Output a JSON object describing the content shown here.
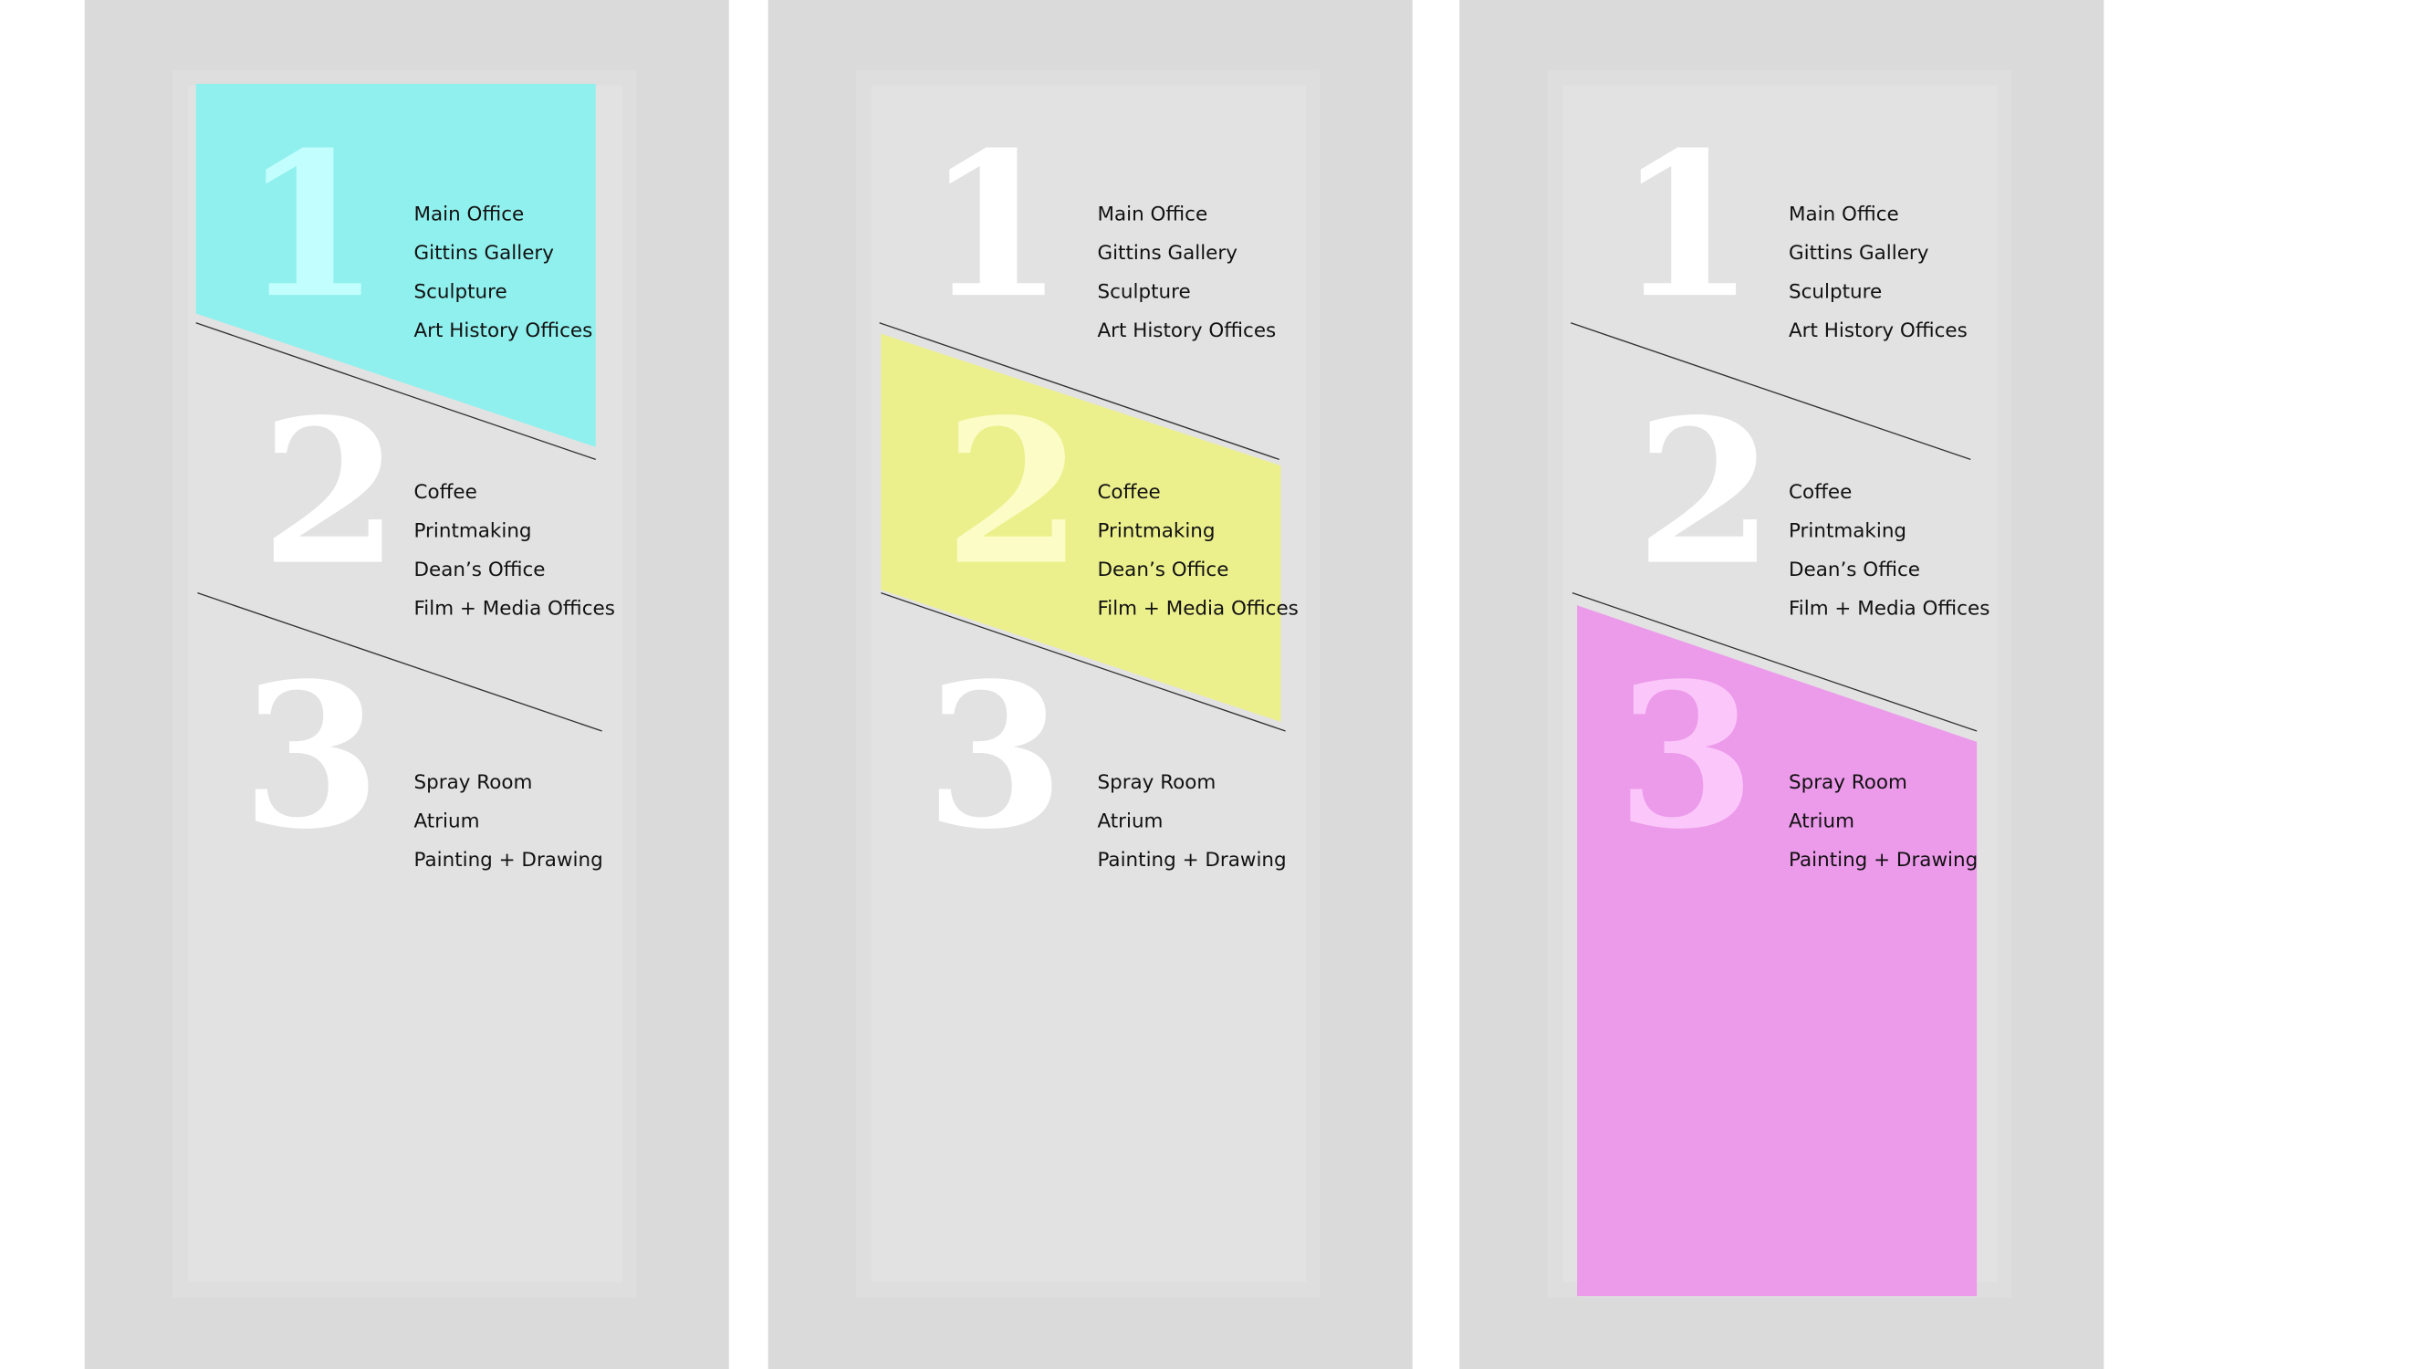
{
  "colors": {
    "background": "#ffffff",
    "panel": "#dadada",
    "board_border": "#dedede",
    "board": "#e2e2e2",
    "number": "#ffffff",
    "divider": "#333333"
  },
  "floors": [
    {
      "number": "1",
      "items": [
        "Main Office",
        "Gittins Gallery",
        "Sculpture",
        "Art History Offices"
      ]
    },
    {
      "number": "2",
      "items": [
        "Coffee",
        "Printmaking",
        "Dean’s Office",
        "Film + Media Offices"
      ]
    },
    {
      "number": "3",
      "items": [
        "Spray Room",
        "Atrium",
        "Painting + Drawing"
      ]
    }
  ],
  "panels": [
    {
      "highlight_floor": 1,
      "highlight_color": "#90f0ee",
      "highlight_number_color": "#c2fefe"
    },
    {
      "highlight_floor": 2,
      "highlight_color": "#ecf08c",
      "highlight_number_color": "#fbfcc6"
    },
    {
      "highlight_floor": 3,
      "highlight_color": "#ec9aea",
      "highlight_number_color": "#fbc6fa"
    }
  ]
}
